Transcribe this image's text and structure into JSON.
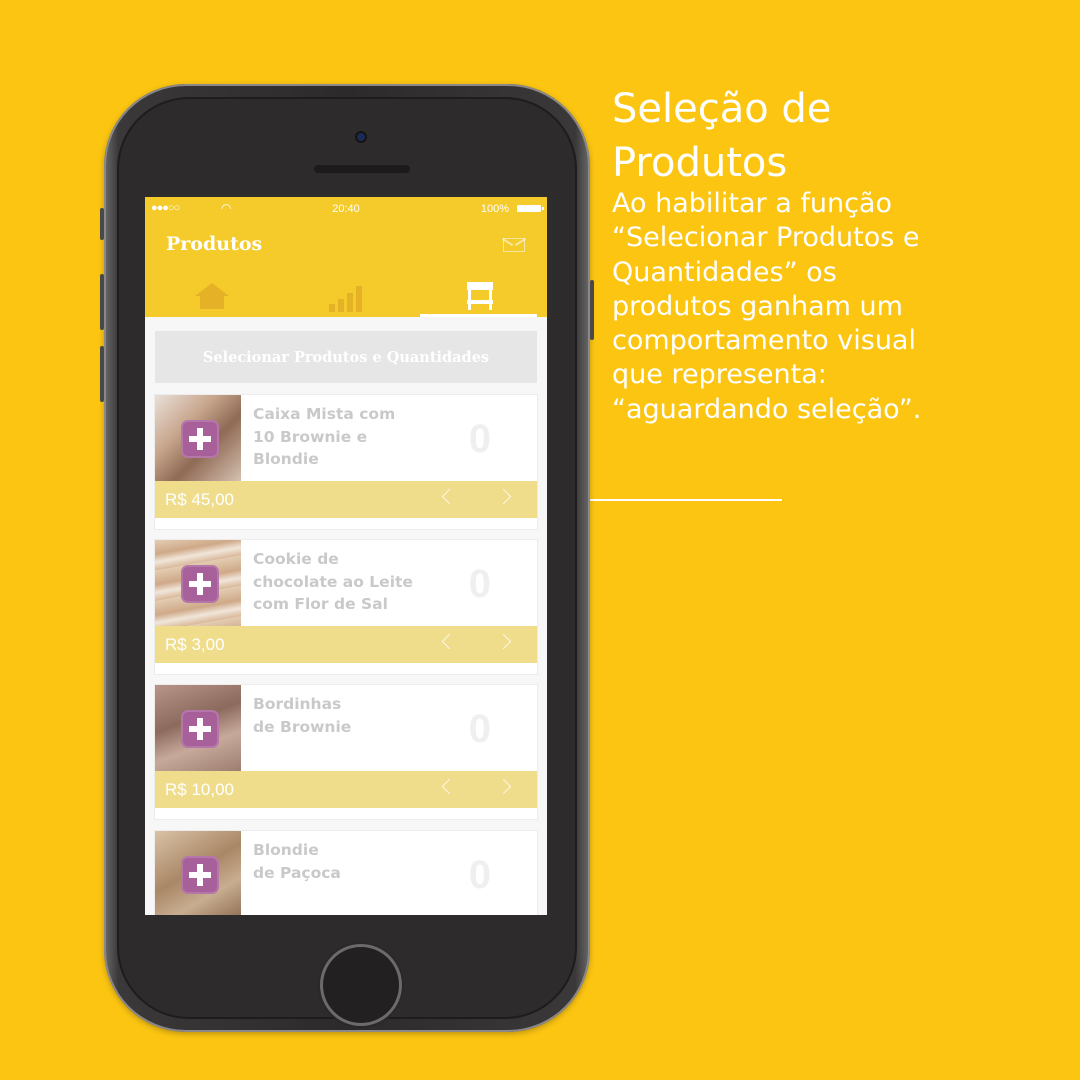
{
  "caption": {
    "headline": "Seleção de\nProdutos",
    "description": "Ao habilitar a função\n“Selecionar Produtos e\nQuantidades” os\nprodutos ganham um\ncomportamento visual\nque representa:\n“aguardando seleção”."
  },
  "status_bar": {
    "carrier": "●●●○○",
    "time": "20:40",
    "battery": "100%"
  },
  "app": {
    "title": "Produtos",
    "tabs": [
      {
        "icon": "home-icon",
        "active": false
      },
      {
        "icon": "chart-icon",
        "active": false
      },
      {
        "icon": "store-stand-icon",
        "active": true
      }
    ],
    "select_button_label": "Selecionar Produtos e Quantidades",
    "products": [
      {
        "name": "Caixa Mista com\n10 Brownie e\nBlondie",
        "price": "R$ 45,00",
        "quantity": "0",
        "thumb_color": "#b89a84"
      },
      {
        "name": "Cookie de\nchocolate ao Leite\ncom Flor de Sal",
        "price": "R$ 3,00",
        "quantity": "0",
        "thumb_color": "#d8b89a"
      },
      {
        "name": "Bordinhas\nde Brownie",
        "price": "R$ 10,00",
        "quantity": "0",
        "thumb_color": "#9f7d6c"
      },
      {
        "name": "Blondie\nde Paçoca",
        "price": "",
        "quantity": "0",
        "thumb_color": "#a88770"
      }
    ]
  },
  "colors": {
    "background": "#FCC512",
    "header": "#F4CB2A",
    "price_bar": "#EFDD8B",
    "plus_button": "#A8609B"
  }
}
